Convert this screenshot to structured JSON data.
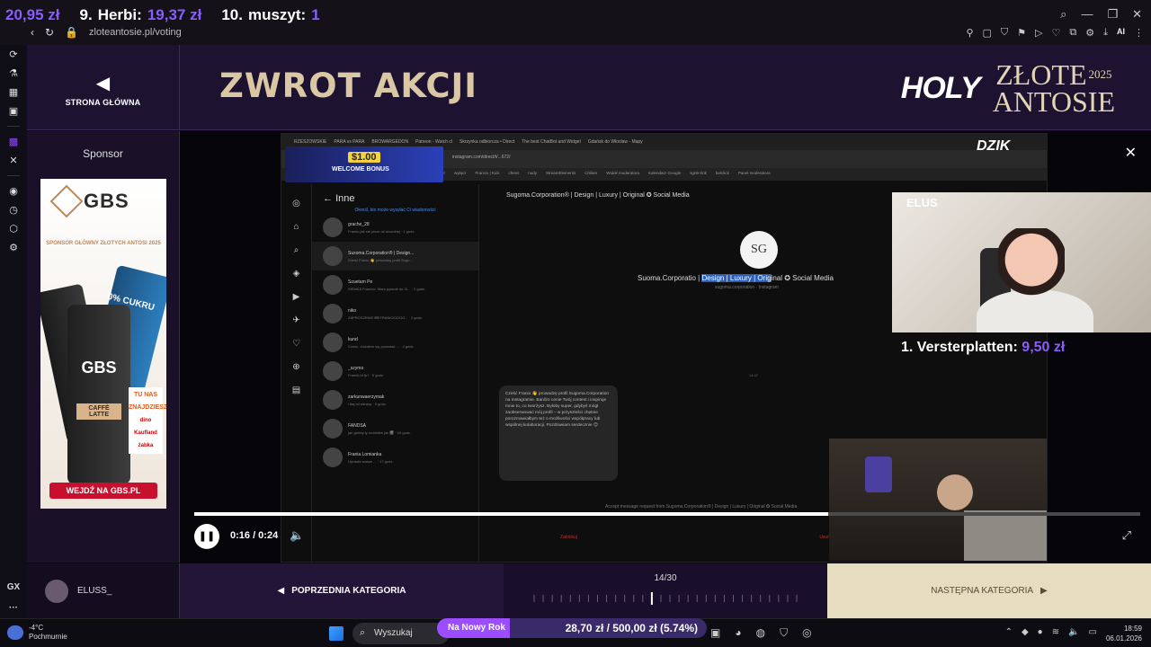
{
  "ticker": [
    {
      "rank": "",
      "name": "",
      "amount": "20,95 zł",
      "partial": true
    },
    {
      "rank": "9.",
      "name": "Herbi:",
      "amount": "19,37 zł"
    },
    {
      "rank": "10.",
      "name": "muszyt:",
      "amount": "1"
    }
  ],
  "browser": {
    "url": "zloteantosie.pl/voting",
    "window_controls": [
      "⌕",
      "—",
      "❐",
      "✕"
    ],
    "extensions": [
      "AI"
    ]
  },
  "header": {
    "home_label": "STRONA GŁÓWNA",
    "title": "ZWROT AKCJI",
    "brand_holy": "HOLY",
    "brand_line1": "ZŁOTE",
    "brand_year": "2025",
    "brand_line2": "ANTOSIE"
  },
  "sponsor": {
    "label": "Sponsor",
    "ad": {
      "brand": "GBS",
      "tagline": "SPONSOR GŁÓWNY ZŁOTYCH ANTOSI 2025",
      "no_sugar": "0% CUKRU",
      "flavor": "CAFFÈ LATTE",
      "stores_title": "TU NAS ZNAJDZIESZ",
      "stores": [
        "dino",
        "Kaufland",
        "żabka"
      ],
      "cta": "WEJDŹ NA GBS.PL"
    }
  },
  "video": {
    "embedded": {
      "tabs": [
        "RZESZOWSKIE",
        "PARA vs PARA",
        "BROWARGEDON",
        "Patreon - Watch cl",
        "Skrzynka odbiorcza • Direct",
        "The best ChatBot and Widget",
        "Gdańsk do Włocław - Mapy"
      ],
      "url": "instagram.com/direct/t/...672/",
      "bookmarks": [
        "twitter",
        "wyłącz",
        "Francis | Kick",
        "chess",
        "nudy",
        "StreamElements",
        "Chilam",
        "Widok moderatora",
        "Kalendarz Google",
        "sgnik-link",
        "betclick",
        "Panel moderatora"
      ],
      "bonus_amount": "$1.00",
      "bonus_label": "WELCOME BONUS",
      "dzik": "DZIK",
      "list_header": "Inne",
      "list_note": "Określ, kto może wysyłać Ci wiadomości",
      "chats": [
        {
          "name": "grache_28",
          "preview": "Franko jak sie pisze do dowolnej · 1 godz."
        },
        {
          "name": "Suxoma.Corporation® | Design...",
          "preview": "Cześć Franio 👋 prowadzę profil Sugo... ",
          "active": true
        },
        {
          "name": "Szuetam Pe",
          "preview": "SIEMKA Franeco. Mam pytanie do Ci... · 2 godz."
        },
        {
          "name": "niko",
          "preview": "ZAPROSZENIE 🎟 FRANIOOOOO... · 2 godz."
        },
        {
          "name": "kund",
          "preview": "Cześć, chciałem się pozostać ... · 4 godz."
        },
        {
          "name": "_szymo",
          "preview": "Franek hi fp? · 5 godz."
        },
        {
          "name": "zarkunwaerzymak",
          "preview": "i daj mi wiedzę · 9 godz."
        },
        {
          "name": "FANDSA",
          "preview": "jan grubty ty zrobbiłeś jak 🎬 · 10 godz."
        },
        {
          "name": "Frania Lomianka",
          "preview": "Uprawie wasze ... · 17 godz."
        }
      ],
      "chat_header": "Sugoma.Corporation® | Design | Luxury | Original ✪ Social Media",
      "chat_title_pre": "Su",
      "chat_title_mid": "oma.Corporatio",
      "chat_title_hl": "Design | Luxury | Orig",
      "chat_title_post": "inal ✪ Social Media",
      "chat_sub": "sugoma.corporation · Instagram",
      "msg_time": "14:47",
      "message": "Cześć Franio 👋 prowadzę profil Sugoma.Corporation na Instagramie. Bardzo cenie Twój content i inspiruje mnie to, co tworzysz. Byłoby super, gdybyś mógł zaobserwować mój profil – w przyszłości chętnie porozmawiałbym też o możliwości współpracy lub wspólnej kolaboracji. Pozdrawiam serdecznie 😊",
      "accept_text": "Accept message request from Sugoma.Corporation® | Design | Luxury | Original ✪ Social Media",
      "btn_block": "Zablokuj",
      "btn_delete": "Usuń"
    },
    "cam_label": "ELUS",
    "top_donor_rank": "1.",
    "top_donor_name": "Versterplatten:",
    "top_donor_amount": "9,50 zł",
    "progress": 0.67,
    "time": "0:16 / 0:24"
  },
  "bottom_nav": {
    "user": "ELUSS_",
    "prev": "POPRZEDNIA KATEGORIA",
    "counter": "14/30",
    "counter_current": 14,
    "counter_total": 30,
    "next": "NASTĘPNA KATEGORIA"
  },
  "taskbar": {
    "temp": "-4°C",
    "weather": "Pochmurnie",
    "search": "Wyszukaj",
    "goal_label": "Na Nowy Rok",
    "goal_value": "28,70 zł / 500,00 zł (5.74%)",
    "goal_fraction": 0.0574,
    "time": "18:59",
    "date": "06.01.2026"
  },
  "colors": {
    "accent": "#8a5cff",
    "gold": "#d9c8a3",
    "nav_next": "#e6dcc0"
  }
}
